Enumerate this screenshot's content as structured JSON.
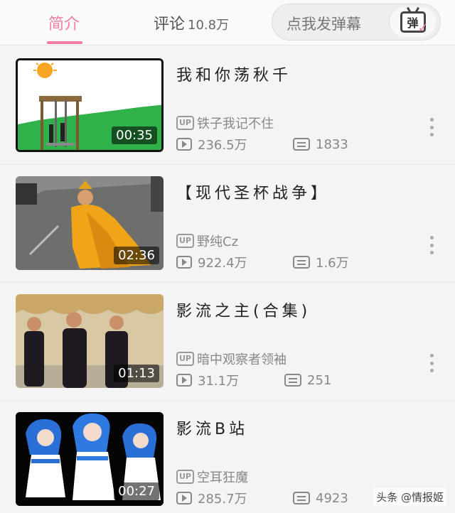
{
  "tabs": {
    "intro_label": "简介",
    "comments_label": "评论",
    "comments_count": "10.8万"
  },
  "danmaku": {
    "placeholder": "点我发弹幕",
    "button_glyph": "弹"
  },
  "videos": [
    {
      "title": "我和你荡秋千",
      "uploader": "铁子我记不住",
      "views": "236.5万",
      "danmaku": "1833",
      "duration": "00:35"
    },
    {
      "title": "【现代圣杯战争】",
      "uploader": "野纯Cz",
      "views": "922.4万",
      "danmaku": "1.6万",
      "duration": "02:36"
    },
    {
      "title": "影流之主(合集)",
      "uploader": "暗中观察者领袖",
      "views": "31.1万",
      "danmaku": "251",
      "duration": "01:13"
    },
    {
      "title": "影流B站",
      "uploader": "空耳狂魔",
      "views": "285.7万",
      "danmaku": "4923",
      "duration": "00:27"
    }
  ],
  "up_badge": "UP",
  "watermark": "头条 @情报姬",
  "colors": {
    "accent": "#f07ea0",
    "muted": "#888888"
  }
}
